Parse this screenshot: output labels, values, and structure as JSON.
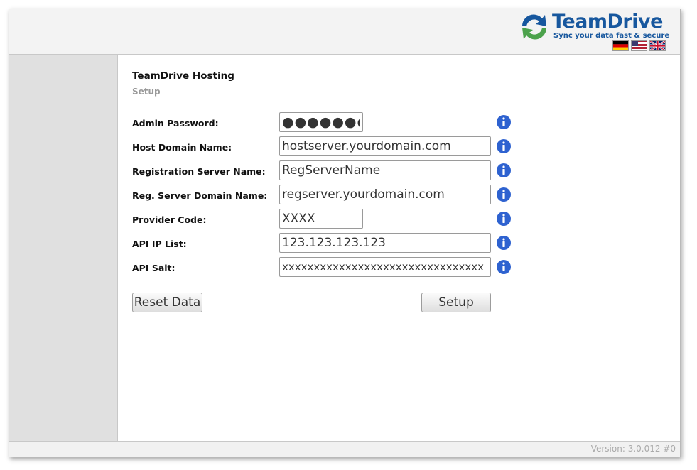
{
  "brand": {
    "name": "TeamDrive",
    "tagline": "Sync your data fast & secure",
    "primary_color": "#17579e",
    "accent_color": "#4ca24c"
  },
  "languages": [
    {
      "code": "de",
      "icon": "german-flag-icon"
    },
    {
      "code": "us",
      "icon": "us-flag-icon"
    },
    {
      "code": "uk",
      "icon": "uk-flag-icon"
    }
  ],
  "page": {
    "title": "TeamDrive Hosting",
    "subtitle": "Setup"
  },
  "form": {
    "fields": [
      {
        "label": "Admin Password:",
        "value": "●●●●●●●",
        "type": "password"
      },
      {
        "label": "Host Domain Name:",
        "value": "hostserver.yourdomain.com"
      },
      {
        "label": "Registration Server Name:",
        "value": "RegServerName"
      },
      {
        "label": "Reg. Server Domain Name:",
        "value": "regserver.yourdomain.com"
      },
      {
        "label": "Provider Code:",
        "value": "XXXX"
      },
      {
        "label": "API IP List:",
        "value": "123.123.123.123"
      },
      {
        "label": "API Salt:",
        "value": "xxxxxxxxxxxxxxxxxxxxxxxxxxxxxxxx"
      }
    ],
    "info_icon": "info-icon",
    "reset_label": "Reset Data",
    "setup_label": "Setup"
  },
  "footer": {
    "version": "Version: 3.0.012 #0"
  }
}
